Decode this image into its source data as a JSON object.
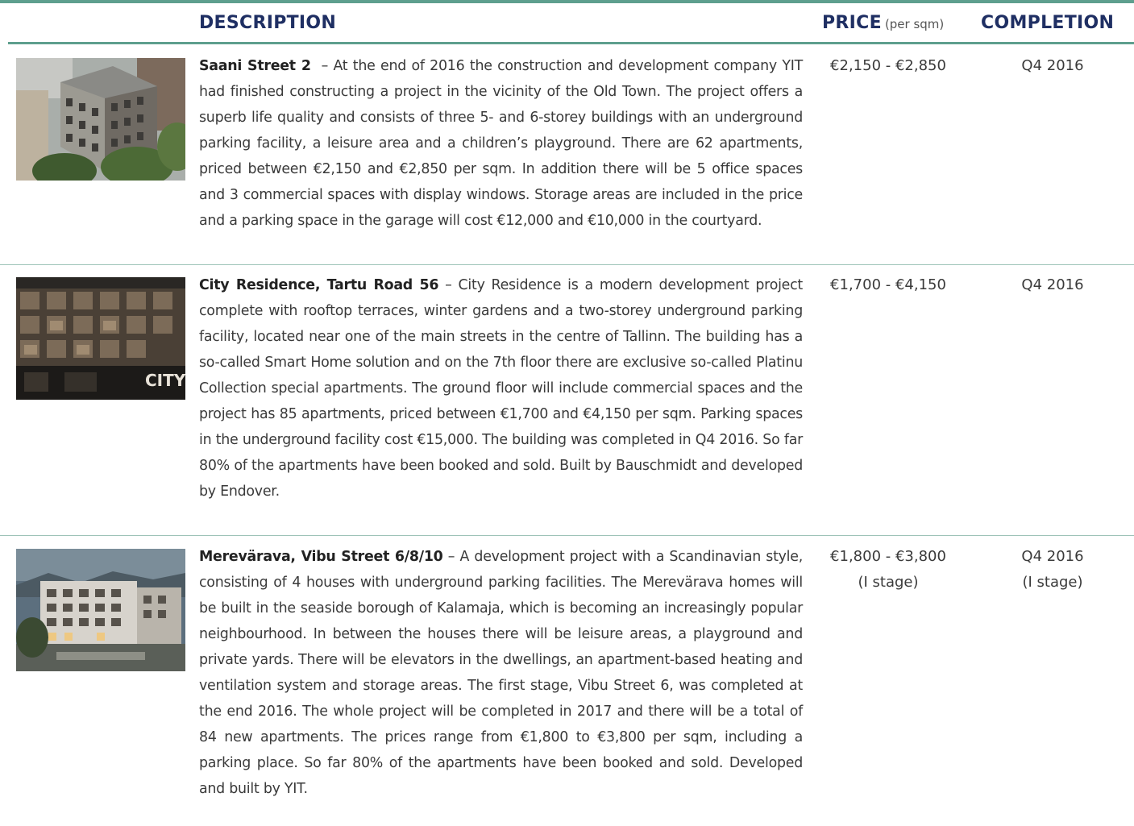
{
  "header": {
    "description": "DESCRIPTION",
    "price": "PRICE",
    "price_sub": "(per sqm)",
    "completion": "COMPLETION"
  },
  "rows": [
    {
      "title": "Saani Street 2",
      "separator": "  – ",
      "text": "At the end of 2016 the construction and development company YIT had finished constructing a project in the vicinity of the Old Town. The project offers a superb life quality and consists of three 5- and 6-storey buildings with an underground parking facility, a leisure area and a children’s playground. There are 62 apartments, priced between €2,150 and €2,850 per sqm. In addition there will be 5 office spaces and 3 commercial spaces with display windows. Storage areas are included in the price and a parking space in the garage will cost €12,000 and €10,000 in the courtyard.",
      "price": "€2,150 - €2,850",
      "price_note": "",
      "completion": "Q4 2016",
      "completion_note": "",
      "image": "building-photo"
    },
    {
      "title": "City Residence, Tartu Road 56",
      "separator": " – ",
      "text": "City Residence is a modern development project complete with rooftop terraces, winter gardens and a two-storey underground parking facility, located near one of the main streets in the centre of Tallinn. The building has a so-called Smart Home solution and on the 7th floor there are exclusive so-called Platinu Collection special apartments. The ground floor will include commercial spaces and the project has 85 apartments, priced between €1,700 and €4,150 per sqm. Parking spaces in the underground facility cost €15,000. The building was completed in Q4 2016. So far 80% of the apartments have been booked and sold. Built by Bauschmidt and developed by Endover.",
      "price": "€1,700 - €4,150",
      "price_note": "",
      "completion": "Q4 2016",
      "completion_note": "",
      "image": "building-photo",
      "image_label": "CITY"
    },
    {
      "title": "Merevärava, Vibu Street 6/8/10",
      "separator": " – ",
      "text": "A development project with a Scandinavian style, consisting of 4 houses with underground parking facilities. The Merevärava homes will be built in the seaside borough of Kalamaja, which is becoming an increasingly popular neighbourhood. In between the houses there will be leisure areas, a playground and private yards. There will be elevators in the dwellings, an apartment-based heating and ventilation system and storage areas. The first stage, Vibu Street 6, was completed at the end 2016. The whole project will be completed in 2017 and there will be a total of 84 new apartments. The prices range from €1,800 to €3,800 per sqm, including a parking place. So far 80% of the apartments have been booked and sold. Developed and built by YIT.",
      "price": "€1,800 - €3,800",
      "price_note": "(I stage)",
      "completion": "Q4 2016",
      "completion_note": "(I stage)",
      "image": "building-photo"
    }
  ],
  "colors": {
    "accent": "#5e9f8e",
    "header_text": "#1f2f63"
  }
}
